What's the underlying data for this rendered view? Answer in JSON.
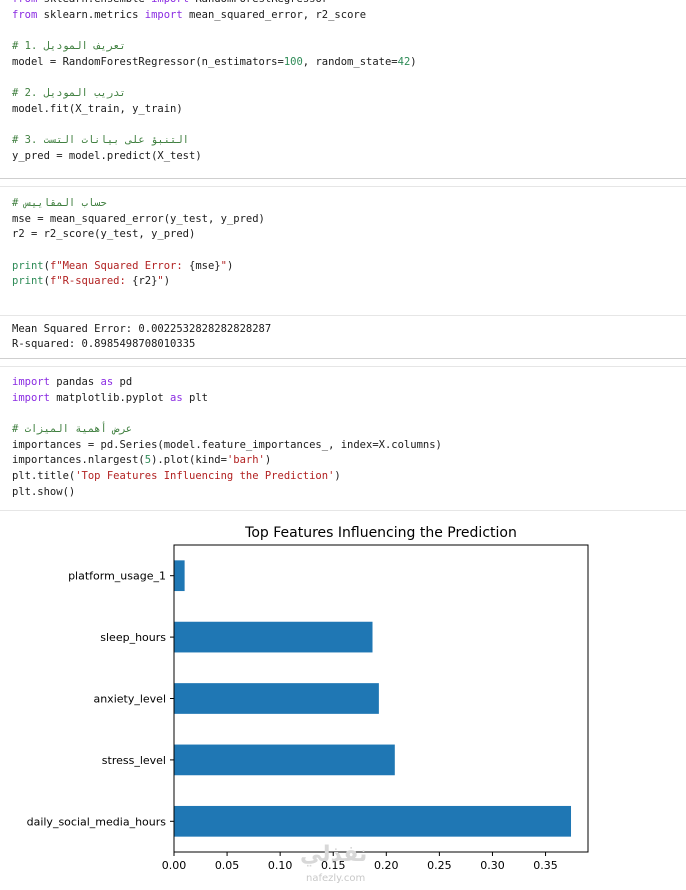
{
  "cell1": {
    "lines": [
      [
        {
          "t": "from",
          "c": "kw2"
        },
        {
          "t": " sklearn.ensemble "
        },
        {
          "t": "import",
          "c": "kw2"
        },
        {
          "t": " RandomForestRegressor"
        }
      ],
      [
        {
          "t": "from",
          "c": "kw2"
        },
        {
          "t": " sklearn.metrics "
        },
        {
          "t": "import",
          "c": "kw2"
        },
        {
          "t": " mean_squared_error, r2_score"
        }
      ],
      [],
      [
        {
          "t": "# 1. تعريف الموديل",
          "c": "cm"
        }
      ],
      [
        {
          "t": "model = RandomForestRegressor(n_estimators="
        },
        {
          "t": "100",
          "c": "num"
        },
        {
          "t": ", random_state="
        },
        {
          "t": "42",
          "c": "num"
        },
        {
          "t": ")"
        }
      ],
      [],
      [
        {
          "t": "# 2. تدريب الموديل",
          "c": "cm"
        }
      ],
      [
        {
          "t": "model.fit(X_train, y_train)"
        }
      ],
      [],
      [
        {
          "t": "# 3. التنبؤ على بيانات التست",
          "c": "cm"
        }
      ],
      [
        {
          "t": "y_pred = model.predict(X_test)"
        }
      ]
    ]
  },
  "cell2": {
    "lines": [
      [
        {
          "t": "# حساب المقاييس",
          "c": "cm"
        }
      ],
      [
        {
          "t": "mse = mean_squared_error(y_test, y_pred)"
        }
      ],
      [
        {
          "t": "r2 = r2_score(y_test, y_pred)"
        }
      ],
      [],
      [
        {
          "t": "print",
          "c": "num"
        },
        {
          "t": "("
        },
        {
          "t": "f\"Mean Squared Error: ",
          "c": "str"
        },
        {
          "t": "{mse}"
        },
        {
          "t": "\"",
          "c": "str"
        },
        {
          "t": ")"
        }
      ],
      [
        {
          "t": "print",
          "c": "num"
        },
        {
          "t": "("
        },
        {
          "t": "f\"R-squared: ",
          "c": "str"
        },
        {
          "t": "{r2}"
        },
        {
          "t": "\"",
          "c": "str"
        },
        {
          "t": ")"
        }
      ]
    ]
  },
  "output2": {
    "lines": [
      "Mean Squared Error: 0.0022532828282828287",
      "R-squared: 0.8985498708010335"
    ]
  },
  "cell3": {
    "lines": [
      [
        {
          "t": "import",
          "c": "kw2"
        },
        {
          "t": " pandas "
        },
        {
          "t": "as",
          "c": "kw2"
        },
        {
          "t": " pd"
        }
      ],
      [
        {
          "t": "import",
          "c": "kw2"
        },
        {
          "t": " matplotlib.pyplot "
        },
        {
          "t": "as",
          "c": "kw2"
        },
        {
          "t": " plt"
        }
      ],
      [],
      [
        {
          "t": "# عرض أهمية الميزات",
          "c": "cm"
        }
      ],
      [
        {
          "t": "importances = pd.Series(model.feature_importances_, index=X.columns)"
        }
      ],
      [
        {
          "t": "importances.nlargest("
        },
        {
          "t": "5",
          "c": "num"
        },
        {
          "t": ").plot(kind="
        },
        {
          "t": "'barh'",
          "c": "str"
        },
        {
          "t": ")"
        }
      ],
      [
        {
          "t": "plt.title("
        },
        {
          "t": "'Top Features Influencing the Prediction'",
          "c": "str"
        },
        {
          "t": ")"
        }
      ],
      [
        {
          "t": "plt.show()"
        }
      ]
    ]
  },
  "chart_data": {
    "type": "bar",
    "orientation": "horizontal",
    "title": "Top Features Influencing the Prediction",
    "categories": [
      "daily_social_media_hours",
      "stress_level",
      "anxiety_level",
      "sleep_hours",
      "platform_usage_1"
    ],
    "values": [
      0.374,
      0.208,
      0.193,
      0.187,
      0.01
    ],
    "xlim": [
      0,
      0.39
    ],
    "xticks": [
      "0.00",
      "0.05",
      "0.10",
      "0.15",
      "0.20",
      "0.25",
      "0.30",
      "0.35"
    ],
    "bar_color": "#1f77b4",
    "grid": false
  },
  "watermark": {
    "text_ar": "نفذلي",
    "text_en": "nafezly.com"
  },
  "colors": {
    "keyword": "#8a2be2",
    "comment": "#3f7f3f",
    "string": "#b22222",
    "number": "#2e8b57"
  }
}
